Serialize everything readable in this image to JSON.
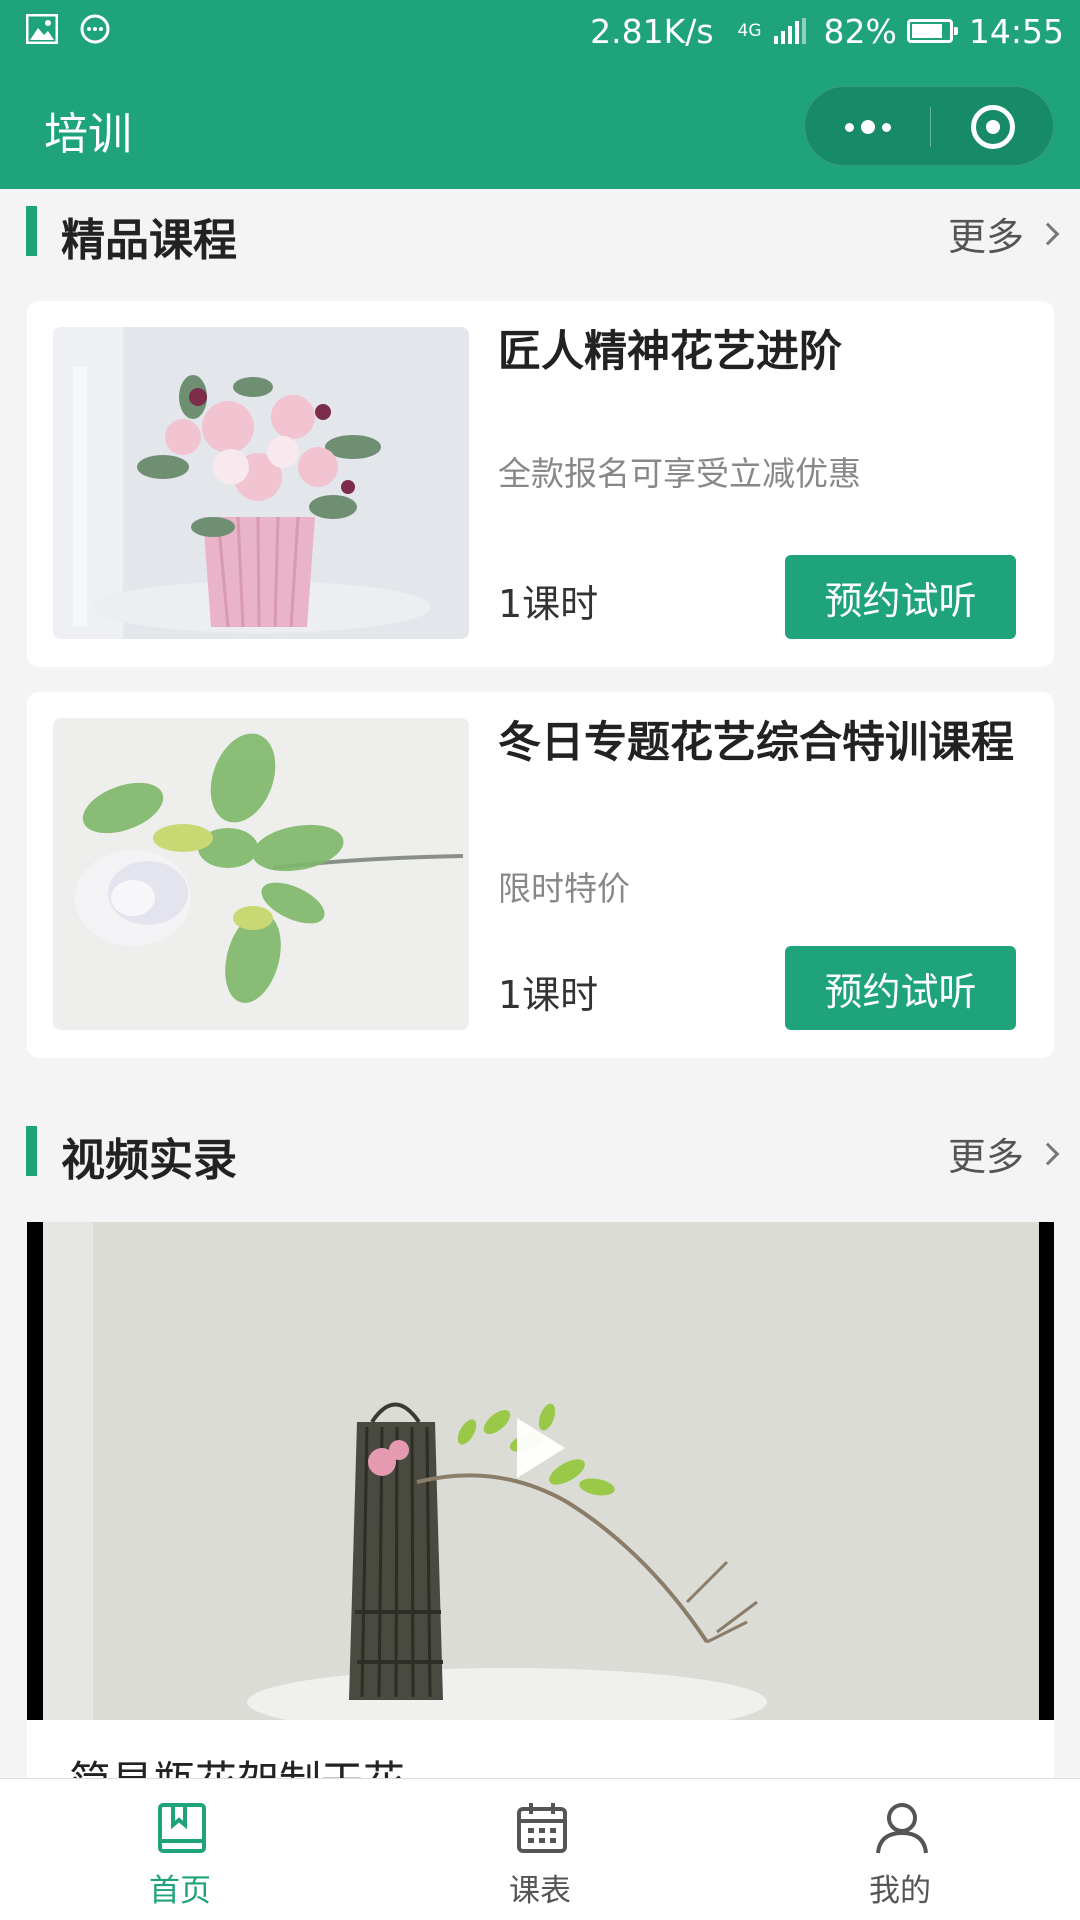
{
  "status_bar": {
    "net_speed": "2.81K/s",
    "network": "4G",
    "battery": "82%",
    "battery_level": 0.82,
    "time": "14:55"
  },
  "nav": {
    "title": "培训"
  },
  "sections": {
    "courses": {
      "title": "精品课程",
      "more_label": "更多",
      "items": [
        {
          "title": "匠人精神花艺进阶",
          "subtitle": "全款报名可享受立减优惠",
          "hours": "1课时",
          "button": "预约试听"
        },
        {
          "title": "冬日专题花艺综合特训课程",
          "subtitle": "限时特价",
          "hours": "1课时",
          "button": "预约试听"
        }
      ]
    },
    "videos": {
      "title": "视频实录",
      "more_label": "更多",
      "items": [
        {
          "title": "简易瓶花架制干花"
        }
      ]
    }
  },
  "tabbar": {
    "items": [
      {
        "label": "首页",
        "icon": "book-icon",
        "active": true
      },
      {
        "label": "课表",
        "icon": "calendar-icon",
        "active": false
      },
      {
        "label": "我的",
        "icon": "user-icon",
        "active": false
      }
    ]
  },
  "colors": {
    "brand": "#1ea37a",
    "active_tab": "#1ea37a",
    "inactive_tab": "#555555",
    "background": "#f4f4f4"
  }
}
